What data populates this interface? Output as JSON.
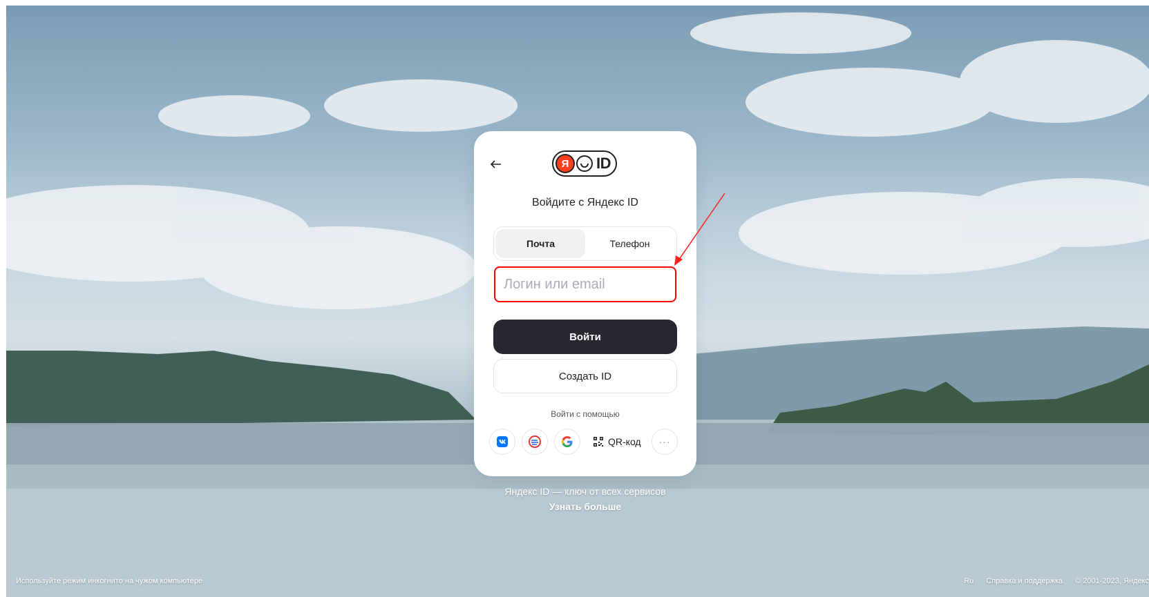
{
  "card": {
    "title": "Войдите с Яндекс ID",
    "logo_letter": "Я",
    "logo_text": "ID",
    "tabs": [
      {
        "label": "Почта",
        "active": true
      },
      {
        "label": "Телефон",
        "active": false
      }
    ],
    "login_placeholder": "Логин или email",
    "login_value": "",
    "submit_label": "Войти",
    "create_label": "Создать ID",
    "alt_login_title": "Войти с помощью",
    "social": [
      {
        "name": "vk-icon"
      },
      {
        "name": "sber-icon"
      },
      {
        "name": "google-icon"
      }
    ],
    "qr_label": "QR-код",
    "more_label": "···"
  },
  "promo": {
    "line1": "Яндекс ID — ключ от всех сервисов",
    "line2": "Узнать больше"
  },
  "footer": {
    "incognito_hint": "Используйте режим инкогнито на чужом компьютере",
    "lang": "Ru",
    "help": "Справка и поддержка",
    "copyright": "© 2001-2023, Яндекс"
  },
  "colors": {
    "accent_dark": "#282830",
    "yandex_red": "#fc3f1d",
    "highlight": "#ff0000"
  }
}
